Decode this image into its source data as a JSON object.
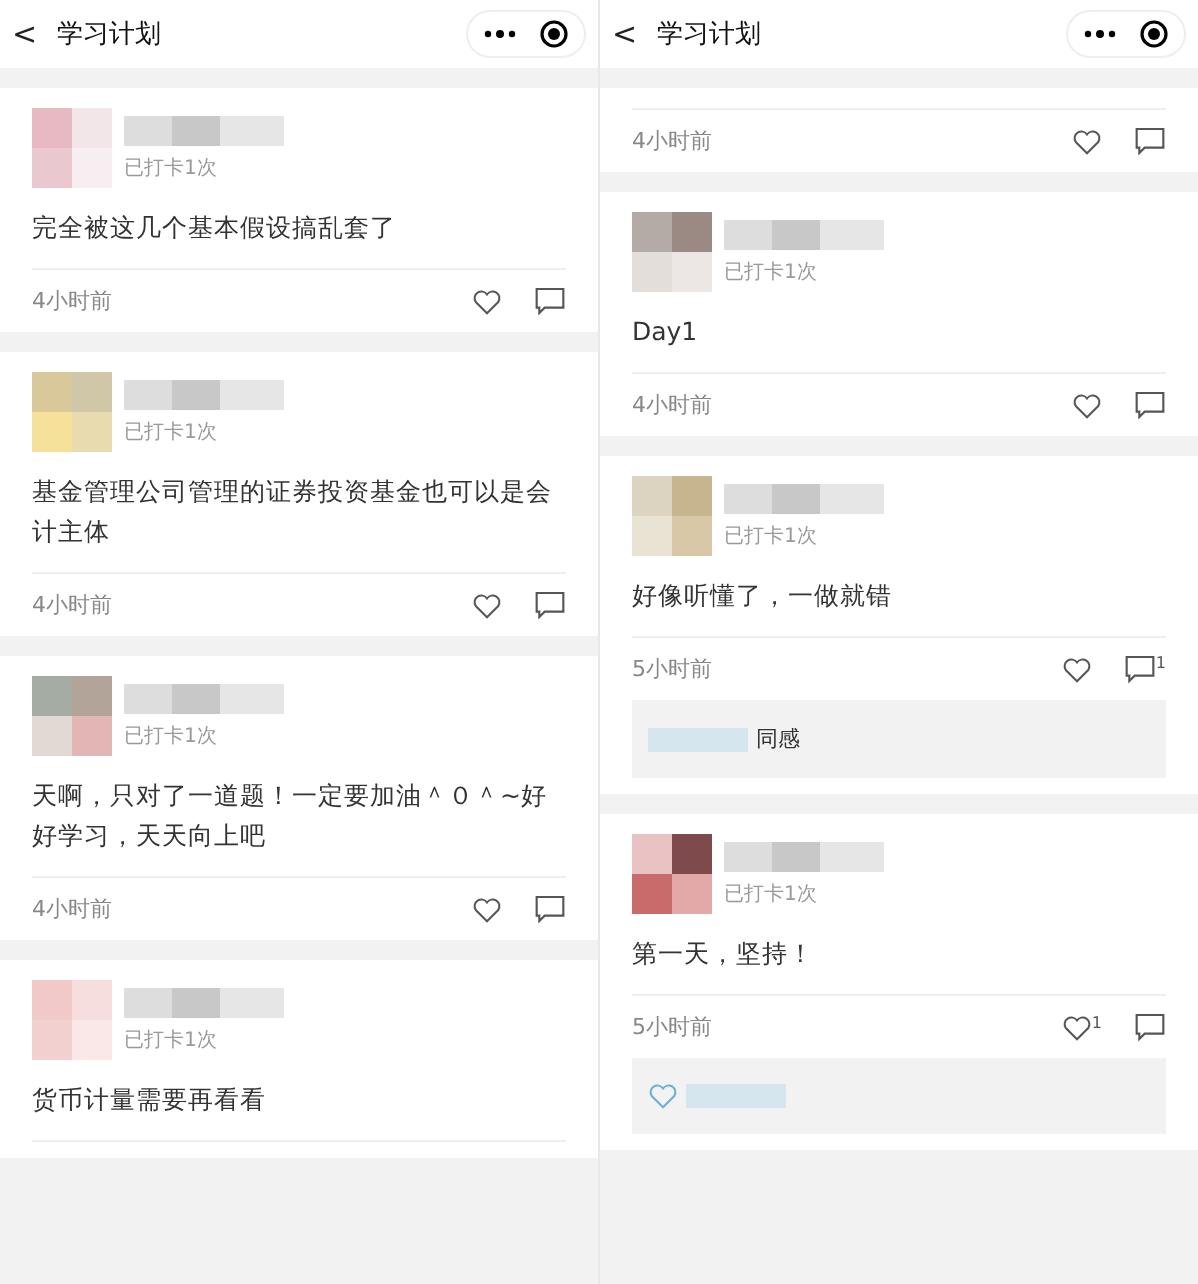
{
  "panels": [
    {
      "title": "学习计划",
      "back": "<",
      "cards": [
        {
          "checkin": "已打卡1次",
          "text": "完全被这几个基本假设搞乱套了",
          "time": "4小时前"
        },
        {
          "checkin": "已打卡1次",
          "text": "基金管理公司管理的证券投资基金也可以是会计主体",
          "time": "4小时前"
        },
        {
          "checkin": "已打卡1次",
          "text": "天啊，只对了一道题！一定要加油＾０＾~好好学习，天天向上吧",
          "time": "4小时前"
        },
        {
          "checkin": "已打卡1次",
          "text": "货币计量需要再看看"
        }
      ]
    },
    {
      "title": "学习计划",
      "back": "<",
      "cards": [
        {
          "time": "4小时前"
        },
        {
          "checkin": "已打卡1次",
          "text": "Day1",
          "time": "4小时前"
        },
        {
          "checkin": "已打卡1次",
          "text": "好像听懂了，一做就错",
          "time": "5小时前",
          "comment_count": "1",
          "replies": [
            {
              "kind": "comment",
              "text": "同感"
            }
          ]
        },
        {
          "checkin": "已打卡1次",
          "text": "第一天，坚持！",
          "time": "5小时前",
          "like_count": "1",
          "replies": [
            {
              "kind": "like"
            }
          ]
        }
      ]
    }
  ]
}
